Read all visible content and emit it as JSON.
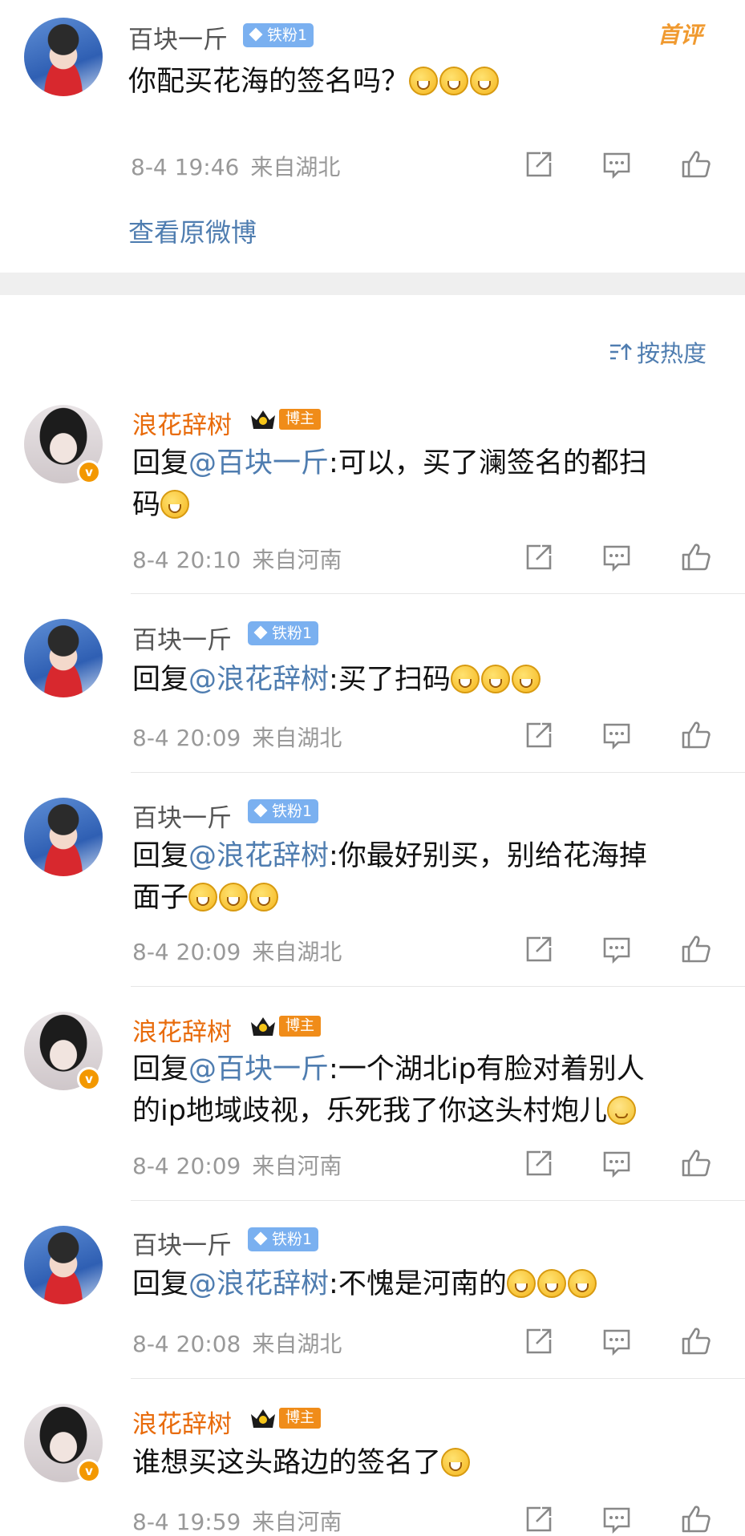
{
  "top_comment": {
    "username": "百块一斤",
    "fan_badge": "铁粉1",
    "first_badge": "首评",
    "text": "你配买花海的签名吗？",
    "emoji_count": 3,
    "time": "8-4 19:46",
    "source": "来自湖北",
    "view_original": "查看原微博"
  },
  "sort_label": "按热度",
  "replies": [
    {
      "user": "浪花辞树",
      "type": "host",
      "tag": "博主",
      "prefix": "回复",
      "mention": "@百块一斤",
      "line1": ":可以，买了澜签名的都扫",
      "line2": "码",
      "emoji": "laugh",
      "emoji_count": 1,
      "time": "8-4 20:10",
      "source": "来自河南"
    },
    {
      "user": "百块一斤",
      "type": "fan",
      "tag": "铁粉1",
      "prefix": "回复",
      "mention": "@浪花辞树",
      "line1": ":买了扫码",
      "emoji": "laugh",
      "emoji_count": 3,
      "time": "8-4 20:09",
      "source": "来自湖北"
    },
    {
      "user": "百块一斤",
      "type": "fan",
      "tag": "铁粉1",
      "prefix": "回复",
      "mention": "@浪花辞树",
      "line1": ":你最好别买，别给花海掉",
      "line2": "面子",
      "emoji": "laugh",
      "emoji_count": 3,
      "time": "8-4 20:09",
      "source": "来自湖北"
    },
    {
      "user": "浪花辞树",
      "type": "host",
      "tag": "博主",
      "prefix": "回复",
      "mention": "@百块一斤",
      "line1": ":一个湖北ip有脸对着别人",
      "line2": "的ip地域歧视，乐死我了你这头村炮儿",
      "emoji": "smile",
      "emoji_count": 1,
      "time": "8-4 20:09",
      "source": "来自河南"
    },
    {
      "user": "百块一斤",
      "type": "fan",
      "tag": "铁粉1",
      "prefix": "回复",
      "mention": "@浪花辞树",
      "line1": ":不愧是河南的",
      "emoji": "laugh",
      "emoji_count": 3,
      "time": "8-4 20:08",
      "source": "来自湖北"
    },
    {
      "user": "浪花辞树",
      "type": "host",
      "tag": "博主",
      "line1": "谁想买这头路边的签名了",
      "emoji": "laugh",
      "emoji_count": 1,
      "time": "8-4 19:59",
      "source": "来自河南"
    }
  ],
  "colors": {
    "mention": "#4f7db0",
    "host_name": "#e86b0b",
    "fan_badge": "#7ab0f0",
    "host_tag": "#f08c19"
  }
}
